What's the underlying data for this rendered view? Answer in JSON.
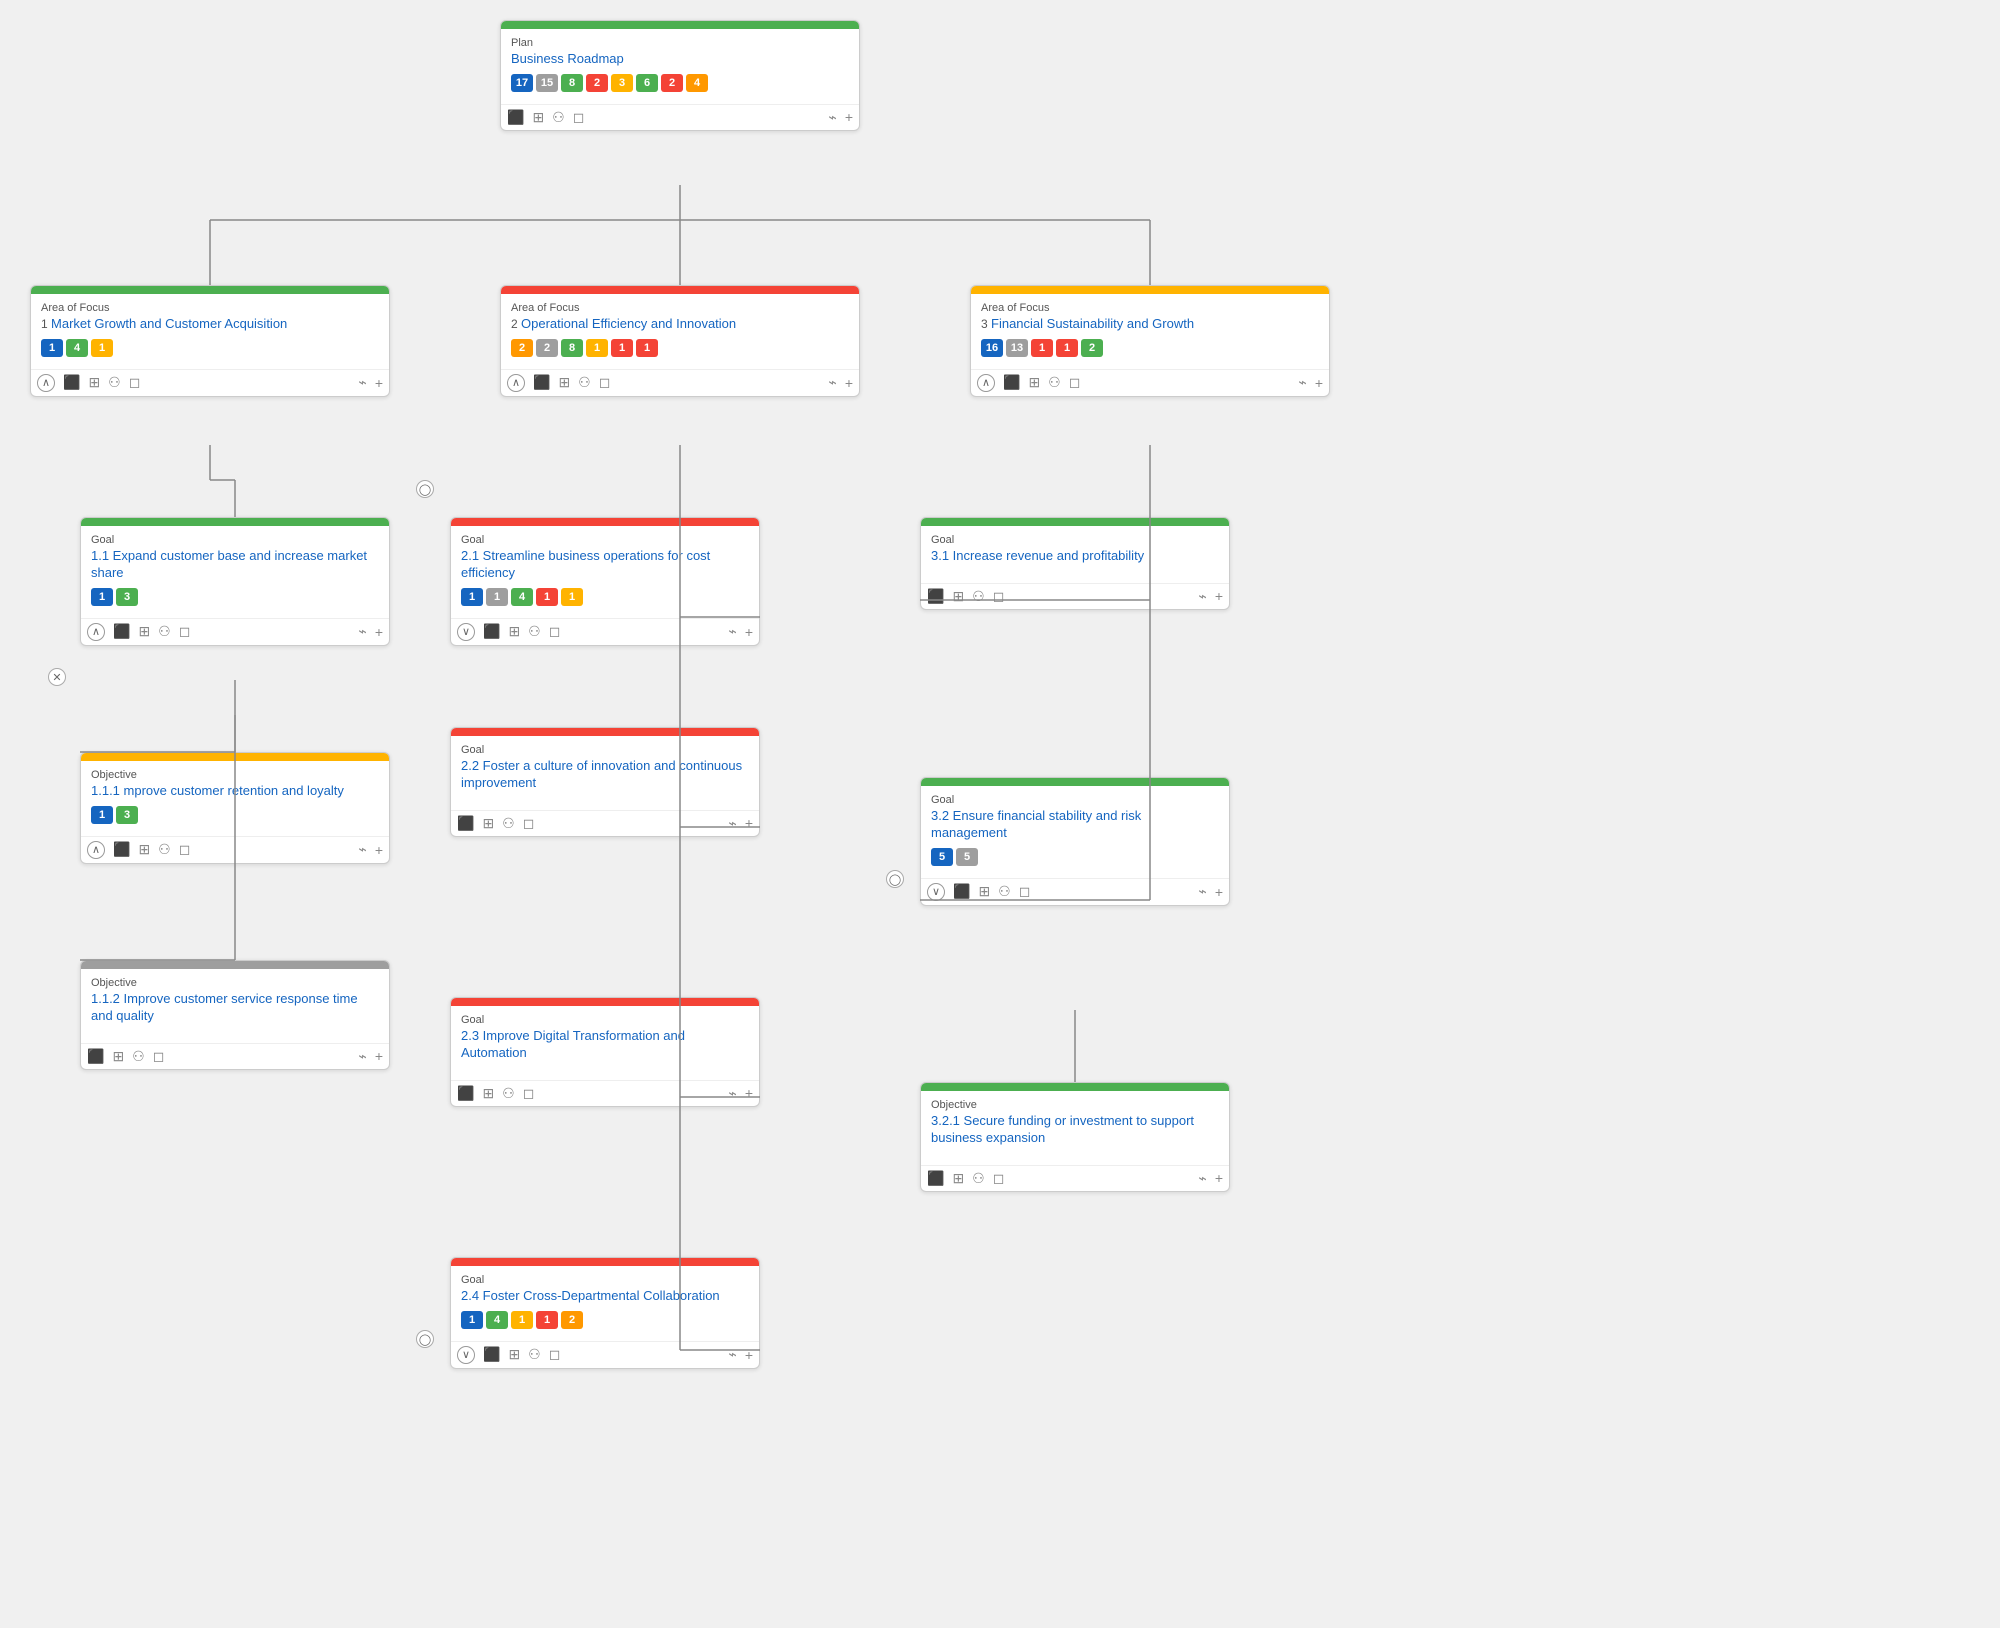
{
  "plan": {
    "type": "Plan",
    "title": "Business Roadmap",
    "badges": [
      {
        "value": "17",
        "color": "badge-blue"
      },
      {
        "value": "15",
        "color": "badge-gray"
      },
      {
        "value": "8",
        "color": "badge-green"
      },
      {
        "value": "2",
        "color": "badge-red"
      },
      {
        "value": "3",
        "color": "badge-yellow"
      },
      {
        "value": "6",
        "color": "badge-green"
      },
      {
        "value": "2",
        "color": "badge-red"
      },
      {
        "value": "4",
        "color": "badge-orange"
      }
    ]
  },
  "areas": [
    {
      "type": "Area of Focus",
      "number": "1",
      "title": "Market Growth and Customer Acquisition",
      "header_color": "header-green",
      "badges": [
        {
          "value": "1",
          "color": "badge-blue"
        },
        {
          "value": "4",
          "color": "badge-green"
        },
        {
          "value": "1",
          "color": "badge-yellow"
        }
      ]
    },
    {
      "type": "Area of Focus",
      "number": "2",
      "title": "Operational Efficiency and Innovation",
      "header_color": "header-red",
      "badges": [
        {
          "value": "2",
          "color": "badge-orange"
        },
        {
          "value": "2",
          "color": "badge-gray"
        },
        {
          "value": "8",
          "color": "badge-green"
        },
        {
          "value": "1",
          "color": "badge-yellow"
        },
        {
          "value": "1",
          "color": "badge-red"
        },
        {
          "value": "1",
          "color": "badge-red"
        }
      ]
    },
    {
      "type": "Area of Focus",
      "number": "3",
      "title": "Financial Sustainability and Growth",
      "header_color": "header-yellow",
      "badges": [
        {
          "value": "16",
          "color": "badge-blue"
        },
        {
          "value": "13",
          "color": "badge-gray"
        },
        {
          "value": "1",
          "color": "badge-red"
        },
        {
          "value": "1",
          "color": "badge-red"
        },
        {
          "value": "2",
          "color": "badge-green"
        }
      ]
    }
  ],
  "goals": {
    "area1": [
      {
        "type": "Goal",
        "id": "1.1",
        "title": "1.1 Expand customer base and increase market share",
        "header_color": "header-green",
        "badges": [
          {
            "value": "1",
            "color": "badge-blue"
          },
          {
            "value": "3",
            "color": "badge-green"
          }
        ]
      }
    ],
    "area2": [
      {
        "type": "Goal",
        "id": "2.1",
        "title": "2.1 Streamline business operations for cost efficiency",
        "header_color": "header-red",
        "badges": [
          {
            "value": "1",
            "color": "badge-blue"
          },
          {
            "value": "1",
            "color": "badge-gray"
          },
          {
            "value": "4",
            "color": "badge-green"
          },
          {
            "value": "1",
            "color": "badge-red"
          },
          {
            "value": "1",
            "color": "badge-yellow"
          }
        ]
      },
      {
        "type": "Goal",
        "id": "2.2",
        "title": "2.2 Foster a culture of innovation and continuous improvement",
        "header_color": "header-red",
        "badges": []
      },
      {
        "type": "Goal",
        "id": "2.3",
        "title": "2.3 Improve Digital Transformation and Automation",
        "header_color": "header-red",
        "badges": []
      },
      {
        "type": "Goal",
        "id": "2.4",
        "title": "2.4 Foster Cross-Departmental Collaboration",
        "header_color": "header-red",
        "badges": [
          {
            "value": "1",
            "color": "badge-blue"
          },
          {
            "value": "4",
            "color": "badge-green"
          },
          {
            "value": "1",
            "color": "badge-yellow"
          },
          {
            "value": "1",
            "color": "badge-red"
          },
          {
            "value": "2",
            "color": "badge-orange"
          }
        ]
      }
    ],
    "area3": [
      {
        "type": "Goal",
        "id": "3.1",
        "title": "3.1 Increase revenue and profitability",
        "header_color": "header-green",
        "badges": []
      },
      {
        "type": "Goal",
        "id": "3.2",
        "title": "3.2 Ensure financial stability and risk management",
        "header_color": "header-green",
        "badges": [
          {
            "value": "5",
            "color": "badge-blue"
          },
          {
            "value": "5",
            "color": "badge-gray"
          }
        ]
      }
    ]
  },
  "objectives": [
    {
      "type": "Objective",
      "id": "1.1.1",
      "title": "1.1.1 mprove customer retention and loyalty",
      "header_color": "header-yellow",
      "badges": [
        {
          "value": "1",
          "color": "badge-blue"
        },
        {
          "value": "3",
          "color": "badge-green"
        }
      ]
    },
    {
      "type": "Objective",
      "id": "1.1.2",
      "title": "1.1.2 Improve customer service response time and quality",
      "header_color": "header-gray",
      "badges": []
    },
    {
      "type": "Objective",
      "id": "3.2.1",
      "title": "3.2.1 Secure funding or investment to support business expansion",
      "header_color": "header-green",
      "badges": []
    }
  ],
  "icons": {
    "chart": "📊",
    "calendar": "📅",
    "people": "👥",
    "chat": "💬",
    "link": "🔗",
    "plus": "+",
    "expand": "^",
    "collapse": "˅",
    "circle_x": "✕",
    "circle_o": "◯"
  }
}
